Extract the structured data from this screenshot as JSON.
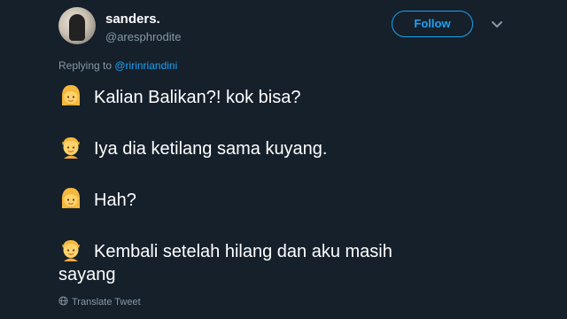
{
  "user": {
    "display_name": "sanders.",
    "handle": "@aresphrodite"
  },
  "actions": {
    "follow_label": "Follow"
  },
  "reply": {
    "prefix": "Replying to ",
    "mention": "@ririnriandini"
  },
  "tweet": {
    "lines": [
      {
        "emoji": "woman-emoji",
        "text": "Kalian Balikan?! kok bisa?"
      },
      {
        "emoji": "person-emoji",
        "text": "Iya dia ketilang sama kuyang."
      },
      {
        "emoji": "woman-emoji",
        "text": "Hah?"
      },
      {
        "emoji": "person-emoji",
        "text": "Kembali setelah hilang dan aku masih",
        "continuation": "sayang"
      }
    ]
  },
  "footer": {
    "translate_label": "Translate Tweet"
  },
  "colors": {
    "background": "#15202b",
    "accent": "#1da1f2",
    "muted": "#8899a6",
    "text": "#ffffff"
  }
}
